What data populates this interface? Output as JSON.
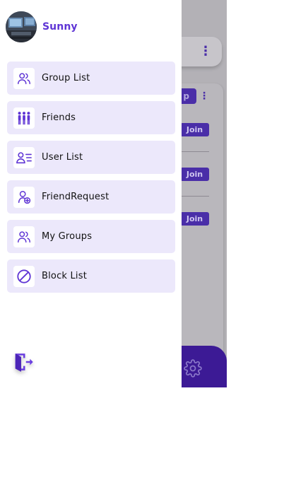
{
  "colors": {
    "accent": "#5f35d5",
    "menu_bg": "#ece8fb",
    "overlay": "#b3b1b6",
    "button_dark": "#4a2ea8"
  },
  "drawer": {
    "user": {
      "name": "Sunny",
      "avatar_icon": "profile-photo"
    },
    "menu": [
      {
        "label": "Group List",
        "icon": "users-icon"
      },
      {
        "label": "Friends",
        "icon": "people-group-icon"
      },
      {
        "label": "User List",
        "icon": "user-list-icon"
      },
      {
        "label": "FriendRequest",
        "icon": "user-add-icon"
      },
      {
        "label": "My Groups",
        "icon": "users-icon"
      },
      {
        "label": "Block List",
        "icon": "block-icon"
      }
    ],
    "logout_icon": "logout-icon"
  },
  "background": {
    "create_button_label": "p",
    "join_label": "Join",
    "settings_icon": "gear-icon"
  }
}
